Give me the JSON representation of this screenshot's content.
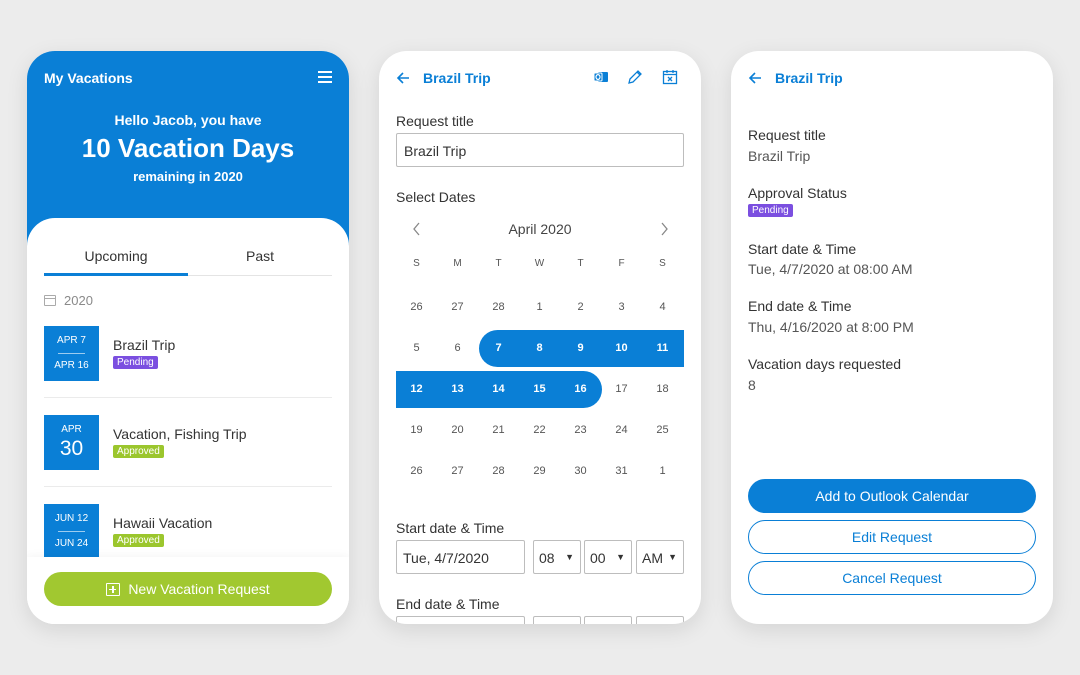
{
  "colors": {
    "brand": "#0a7fd6",
    "accent_green": "#a1c830",
    "pending": "#7b4fe0",
    "approved": "#9bc62d"
  },
  "screen1": {
    "app_title": "My Vacations",
    "greeting": "Hello Jacob, you have",
    "days": "10 Vacation Days",
    "remaining": "remaining in 2020",
    "tabs": [
      "Upcoming",
      "Past"
    ],
    "year": "2020",
    "trips": [
      {
        "date_start": "APR 7",
        "date_end": "APR 16",
        "name": "Brazil Trip",
        "status": "Pending"
      },
      {
        "month": "APR",
        "day": "30",
        "name": "Vacation, Fishing Trip",
        "status": "Approved"
      },
      {
        "date_start": "JUN 12",
        "date_end": "JUN 24",
        "name": "Hawaii Vacation",
        "status": "Approved"
      }
    ],
    "new_request": "New Vacation Request"
  },
  "screen2": {
    "title": "Brazil Trip",
    "request_title_label": "Request title",
    "request_title_value": "Brazil Trip",
    "select_dates_label": "Select Dates",
    "month": "April 2020",
    "weekdays": [
      "S",
      "M",
      "T",
      "W",
      "T",
      "F",
      "S"
    ],
    "weeks": [
      [
        "26",
        "27",
        "28",
        "1",
        "2",
        "3",
        "4"
      ],
      [
        "5",
        "6",
        "7",
        "8",
        "9",
        "10",
        "11"
      ],
      [
        "12",
        "13",
        "14",
        "15",
        "16",
        "17",
        "18"
      ],
      [
        "19",
        "20",
        "21",
        "22",
        "23",
        "24",
        "25"
      ],
      [
        "26",
        "27",
        "28",
        "29",
        "30",
        "31",
        "1"
      ]
    ],
    "start_label": "Start date & Time",
    "start_date": "Tue, 4/7/2020",
    "start_hour": "08",
    "start_min": "00",
    "start_ampm": "AM",
    "end_label": "End date & Time"
  },
  "screen3": {
    "title": "Brazil Trip",
    "request_title_label": "Request title",
    "request_title_value": "Brazil Trip",
    "approval_label": "Approval Status",
    "approval_value": "Pending",
    "start_label": "Start date & Time",
    "start_value": "Tue, 4/7/2020 at 08:00 AM",
    "end_label": "End date & Time",
    "end_value": "Thu, 4/16/2020 at 8:00 PM",
    "days_label": "Vacation days requested",
    "days_value": "8",
    "btn_outlook": "Add to Outlook Calendar",
    "btn_edit": "Edit Request",
    "btn_cancel": "Cancel Request"
  }
}
